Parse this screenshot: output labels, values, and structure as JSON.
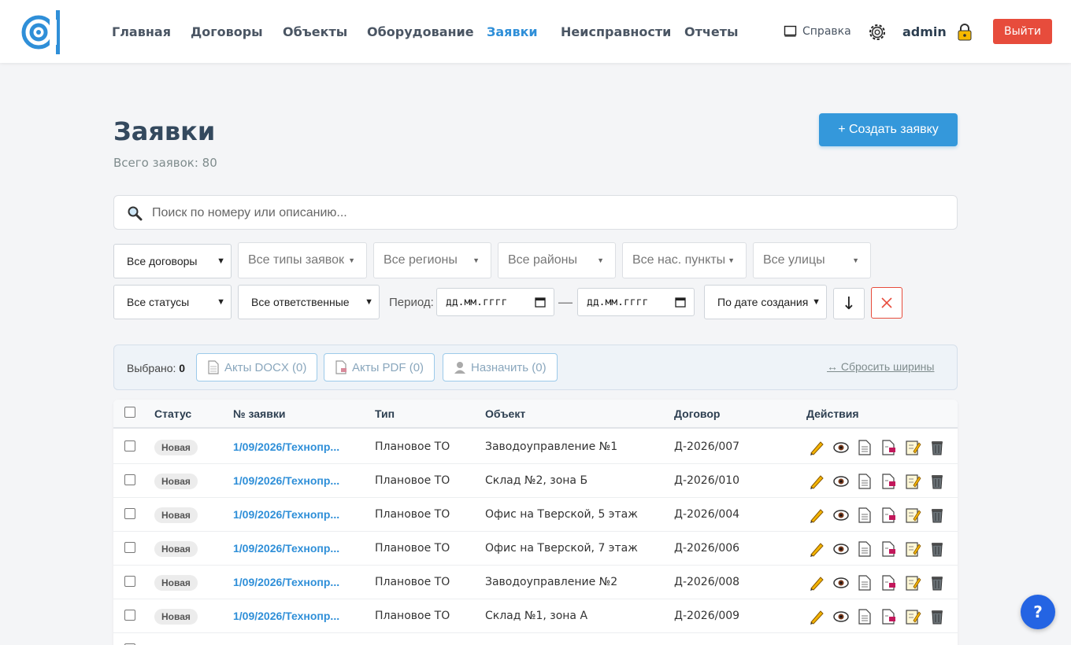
{
  "nav": {
    "items": [
      "Главная",
      "Договоры",
      "Объекты",
      "Оборудование",
      "Заявки",
      "Неисправности",
      "Отчеты"
    ],
    "active_index": 4,
    "help": "Справка",
    "username": "admin",
    "logout": "Выйти"
  },
  "page": {
    "title": "Заявки",
    "subtitle": "Всего заявок: 80",
    "create_button": "+ Создать заявку"
  },
  "search": {
    "placeholder": "Поиск по номеру или описанию..."
  },
  "filters": {
    "contracts": "Все договоры",
    "types": "Все типы заявок",
    "regions": "Все регионы",
    "districts": "Все районы",
    "settlements": "Все нас. пункты",
    "streets": "Все улицы",
    "statuses": "Все статусы",
    "assignees": "Все ответственные",
    "period_label": "Период:",
    "date_from": "дд.мм.гггг",
    "date_to": "дд.мм.гггг",
    "sort": "По дате создания",
    "sort_direction": "↓"
  },
  "bulk": {
    "selected_label": "Выбрано:",
    "selected_count": "0",
    "docx": "Акты DOCX (0)",
    "pdf": "Акты PDF (0)",
    "assign": "Назначить (0)",
    "reset_widths": "↔ Сбросить ширины"
  },
  "table": {
    "headers": [
      "Статус",
      "№ заявки",
      "Тип",
      "Объект",
      "Договор",
      "Действия"
    ],
    "rows": [
      {
        "status": "Новая",
        "number": "1/09/2026/Технопр...",
        "type": "Плановое ТО",
        "object": "Заводоуправление №1",
        "contract": "Д-2026/007"
      },
      {
        "status": "Новая",
        "number": "1/09/2026/Технопр...",
        "type": "Плановое ТО",
        "object": "Склад №2, зона Б",
        "contract": "Д-2026/010"
      },
      {
        "status": "Новая",
        "number": "1/09/2026/Технопр...",
        "type": "Плановое ТО",
        "object": "Офис на Тверской, 5 этаж",
        "contract": "Д-2026/004"
      },
      {
        "status": "Новая",
        "number": "1/09/2026/Технопр...",
        "type": "Плановое ТО",
        "object": "Офис на Тверской, 7 этаж",
        "contract": "Д-2026/006"
      },
      {
        "status": "Новая",
        "number": "1/09/2026/Технопр...",
        "type": "Плановое ТО",
        "object": "Заводоуправление №2",
        "contract": "Д-2026/008"
      },
      {
        "status": "Новая",
        "number": "1/09/2026/Технопр...",
        "type": "Плановое ТО",
        "object": "Склад №1, зона А",
        "contract": "Д-2026/009"
      }
    ]
  },
  "help_fab": "?",
  "colors": {
    "accent": "#3498db",
    "danger": "#e74c3c",
    "link": "#2f8fd8"
  }
}
